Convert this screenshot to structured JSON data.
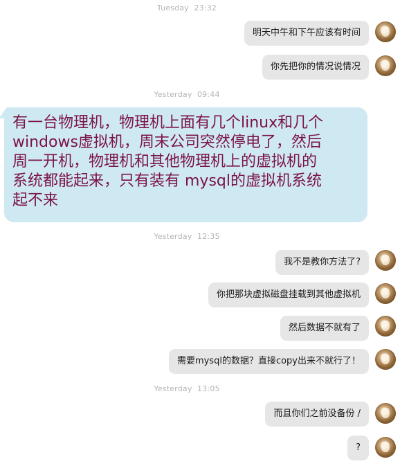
{
  "timestamps": [
    {
      "day": "Tuesday",
      "time": "23:32"
    },
    {
      "day": "Yesterday",
      "time": "09:44"
    },
    {
      "day": "Yesterday",
      "time": "12:35"
    },
    {
      "day": "Yesterday",
      "time": "13:05"
    }
  ],
  "messages": [
    {
      "text": "明天中午和下午应该有时间",
      "direction": "outgoing"
    },
    {
      "text": "你先把你的情况说情况",
      "direction": "outgoing"
    },
    {
      "lines": [
        "有一台物理机，物理机上面有几个linux和几个",
        "windows虚拟机，周末公司突然停电了，然后",
        "周一开机，物理机和其他物理机上的虚拟机的",
        "系统都能起来，只有装有 mysql的虚拟机系统",
        "起不来"
      ],
      "direction": "incoming"
    },
    {
      "text": "我不是教你方法了?",
      "direction": "outgoing"
    },
    {
      "text": "你把那块虚拟磁盘挂载到其他虚拟机",
      "direction": "outgoing"
    },
    {
      "text": "然后数据不就有了",
      "direction": "outgoing"
    },
    {
      "text": "需要mysql的数据？直接copy出来不就行了！",
      "direction": "outgoing"
    },
    {
      "text": "而且你们之前没备份 /",
      "direction": "outgoing"
    },
    {
      "text": "?",
      "direction": "outgoing"
    }
  ],
  "colors": {
    "outgoing_bubble": "#e6e6e6",
    "incoming_bubble": "#cfe9f3",
    "incoming_text": "#7b1346",
    "timestamp": "#b4b4b4"
  }
}
